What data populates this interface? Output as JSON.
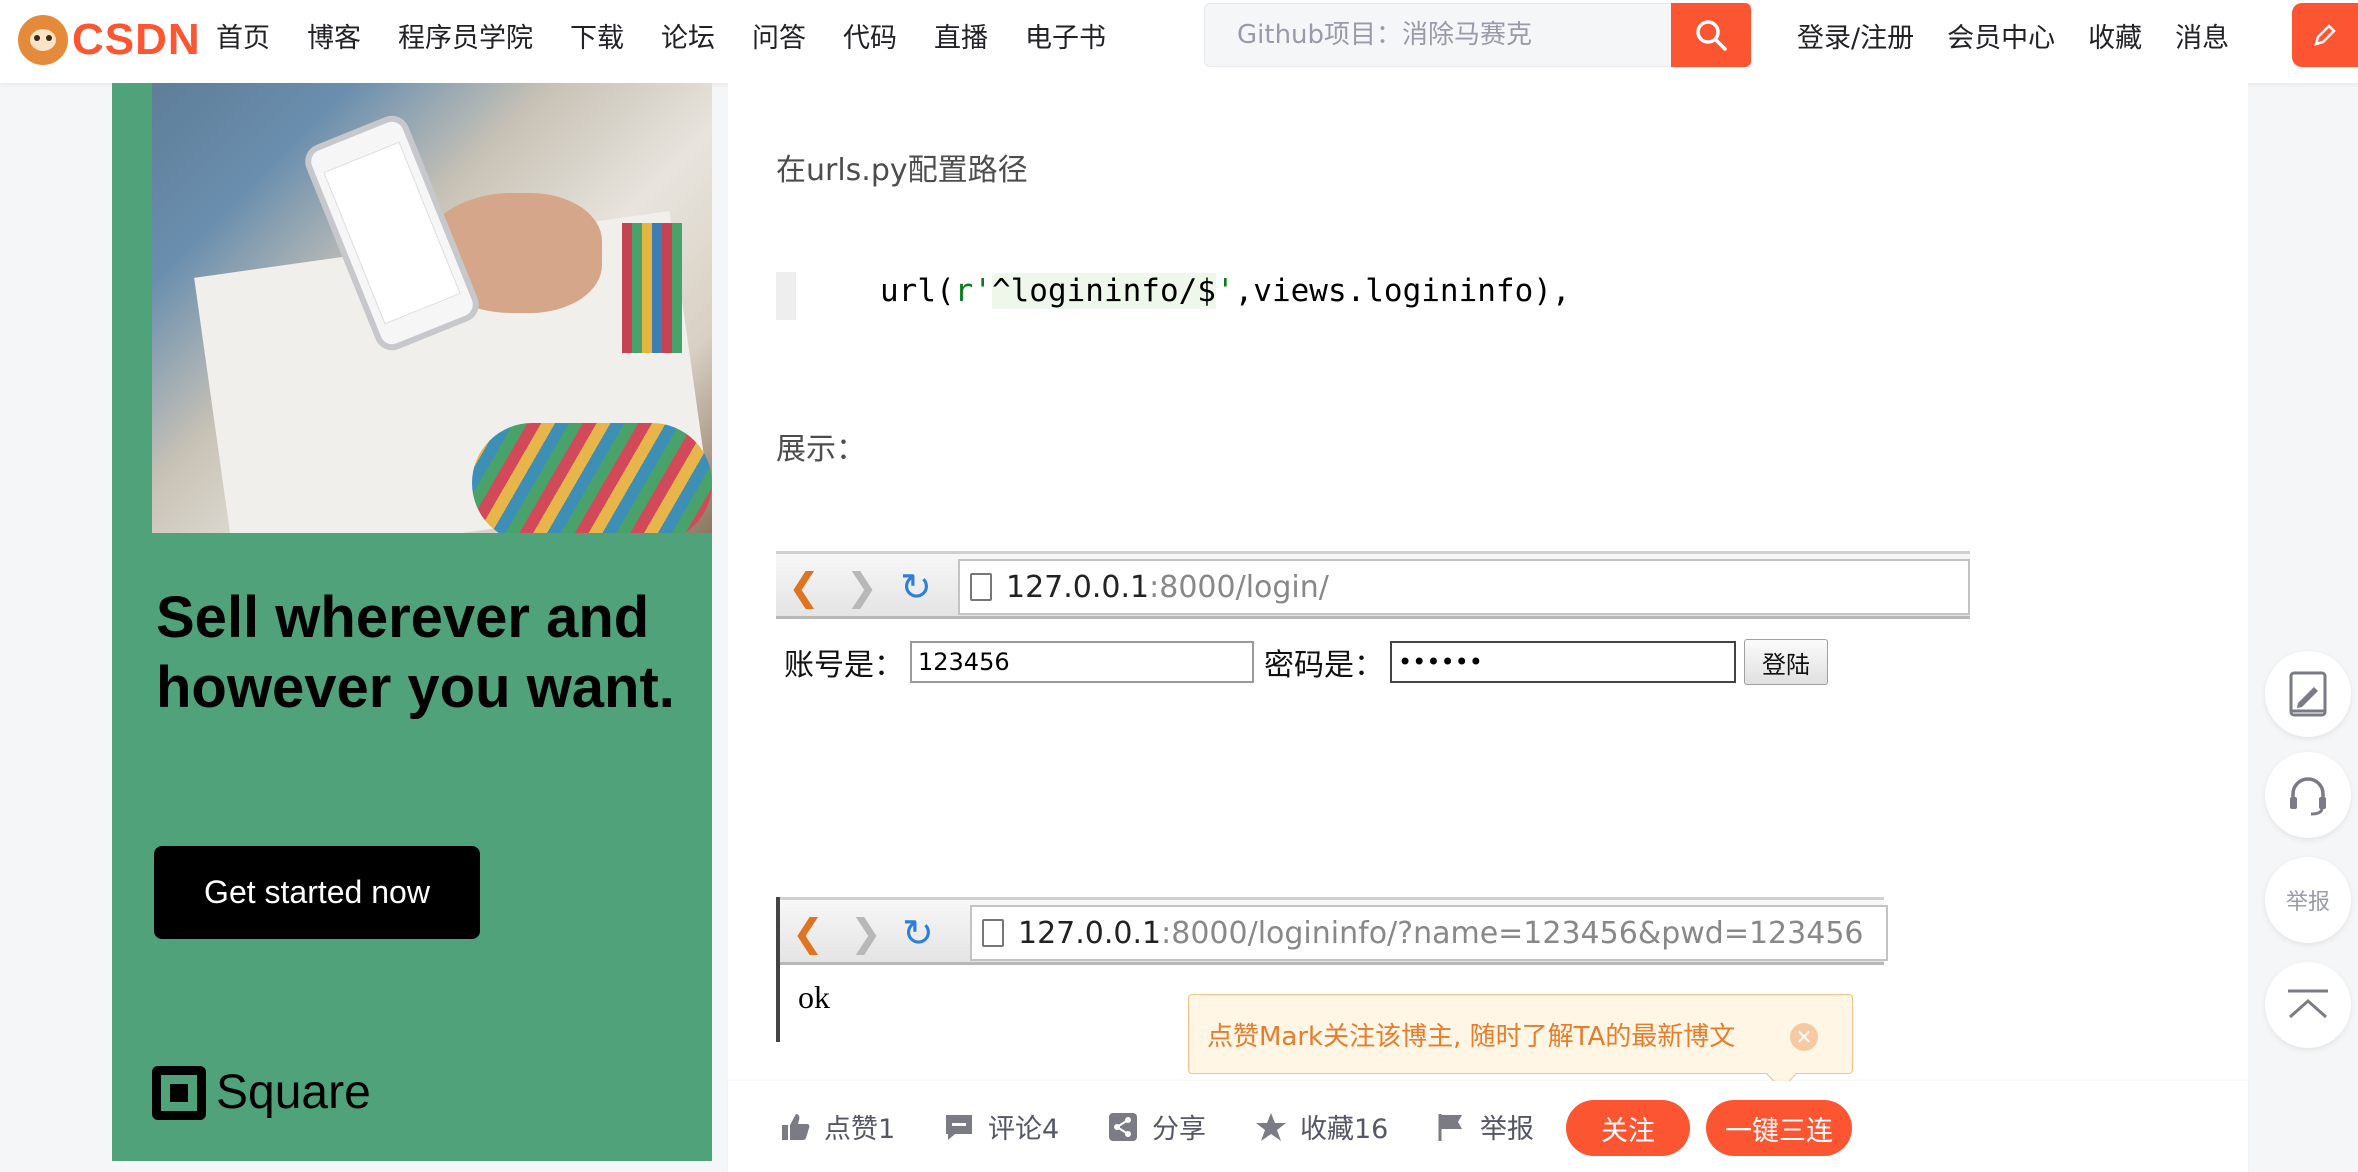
{
  "header": {
    "logo_text": "CSDN",
    "nav": [
      "首页",
      "博客",
      "程序员学院",
      "下载",
      "论坛",
      "问答",
      "代码",
      "直播",
      "电子书"
    ],
    "search_placeholder": "Github项目：消除马赛克",
    "right_nav": [
      "登录/注册",
      "会员中心",
      "收藏",
      "消息"
    ],
    "write_label": "创作"
  },
  "ad": {
    "headline": "Sell wherever and however you want.",
    "button": "Get started now",
    "brand": "Square"
  },
  "article": {
    "config_text": "在urls.py配置路径",
    "code_prefix": "url(",
    "code_r": "r'",
    "code_pattern": "^logininfo/$",
    "code_quote": "'",
    "code_suffix": ",views.logininfo),",
    "display_text": "展示：",
    "browser1": {
      "url_host": "127.0.0.1",
      "url_path": ":8000/login/",
      "account_label": "账号是：",
      "account_value": "123456",
      "password_label": "密码是：",
      "password_value": "••••••",
      "submit": "登陆"
    },
    "browser2": {
      "url_host": "127.0.0.1",
      "url_path": ":8000/logininfo/?name=123456&pwd=123456",
      "output": "ok"
    }
  },
  "toast": {
    "text": "点赞Mark关注该博主, 随时了解TA的最新博文"
  },
  "toolbar": {
    "like": "点赞1",
    "comment": "评论4",
    "share": "分享",
    "favorite": "收藏16",
    "report": "举报",
    "follow": "关注",
    "triple": "一键三连"
  },
  "sidebar": {
    "report": "举报"
  },
  "colors": {
    "brand": "#fc5531",
    "ad_bg": "#4fa27a",
    "toast_text": "#e57d2c"
  }
}
